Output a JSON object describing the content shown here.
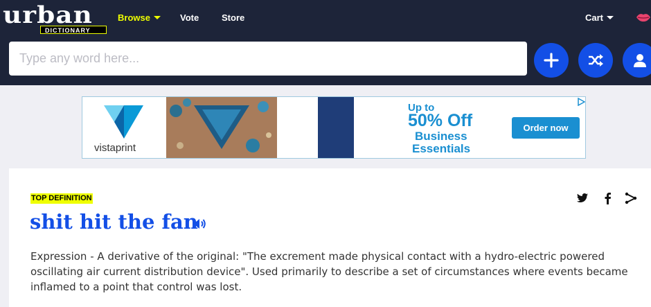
{
  "header": {
    "logo_main": "urban",
    "logo_sub": "DICTIONARY",
    "nav": {
      "browse": "Browse",
      "vote": "Vote",
      "store": "Store",
      "cart": "Cart"
    },
    "accent_color": "#efff00",
    "background_color": "#1d2439"
  },
  "search": {
    "placeholder": "Type any word here...",
    "value": "",
    "buttons": [
      "plus-icon",
      "shuffle-icon",
      "user-icon"
    ],
    "button_color": "#134fe6"
  },
  "ad": {
    "brand": "vistaprint",
    "offer_line1": "Up to",
    "offer_line2": "50% Off",
    "offer_line3": "Business",
    "offer_line4": "Essentials",
    "cta": "Order now",
    "accent_color": "#1a8fd1"
  },
  "definition": {
    "badge": "TOP DEFINITION",
    "word": "shit hit the fan",
    "meaning": "Expression - A derivative of the original: \"The excrement made physical contact with a hydro-electric powered oscillating air current distribution device\". Used primarily to describe a set of circumstances where events became inflamed to a point that control was lost.",
    "share_icons": [
      "twitter-icon",
      "facebook-icon",
      "share-icon"
    ],
    "title_color": "#134fe6"
  }
}
